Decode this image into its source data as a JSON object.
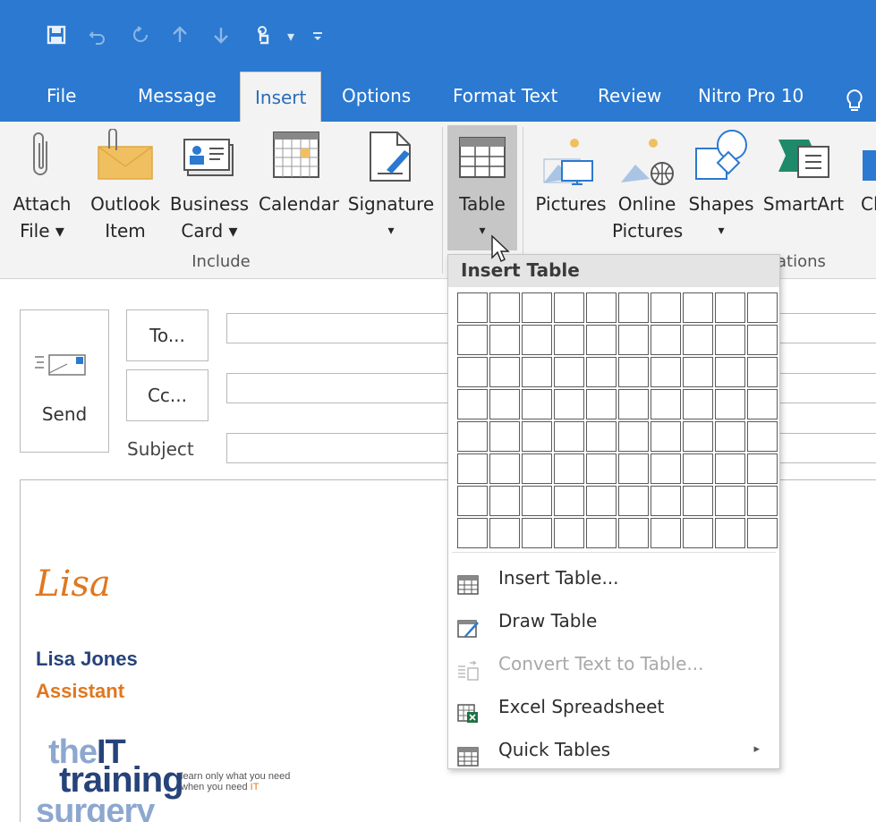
{
  "qat": {
    "icons": [
      "save-icon",
      "undo-icon",
      "redo-icon",
      "up-arrow-icon",
      "down-arrow-icon",
      "touch-mode-icon",
      "customize-icon"
    ],
    "touch_dropdown": "▾",
    "customize": "▾"
  },
  "tabs": [
    "File",
    "Message",
    "Insert",
    "Options",
    "Format Text",
    "Review",
    "Nitro Pro 10"
  ],
  "active_tab": "Insert",
  "ribbon": {
    "include": {
      "label": "Include",
      "buttons": [
        {
          "line1": "Attach",
          "line2": "File ▾"
        },
        {
          "line1": "Outlook",
          "line2": "Item"
        },
        {
          "line1": "Business",
          "line2": "Card ▾"
        },
        {
          "line1": "Calendar",
          "line2": ""
        },
        {
          "line1": "Signature",
          "line2": "▾"
        }
      ]
    },
    "table": {
      "line1": "Table",
      "line2": "▾"
    },
    "illustrations": {
      "label_partial": "ations",
      "buttons": [
        {
          "line1": "Pictures",
          "line2": ""
        },
        {
          "line1": "Online",
          "line2": "Pictures"
        },
        {
          "line1": "Shapes",
          "line2": "▾"
        },
        {
          "line1": "SmartArt",
          "line2": ""
        },
        {
          "line1": "Cl",
          "line2": ""
        }
      ]
    }
  },
  "compose": {
    "send": "Send",
    "to": "To...",
    "cc": "Cc...",
    "subject": "Subject"
  },
  "signature": {
    "script_name": "Lisa",
    "name": "Lisa Jones",
    "title": "Assistant",
    "logo_the": "the",
    "logo_it": "IT",
    "logo_training": "training",
    "logo_surgery": "surgery",
    "tagline_1": "learn only what you need",
    "tagline_2a": "when you need ",
    "tagline_2b": "IT"
  },
  "insert_table_menu": {
    "header": "Insert Table",
    "grid_cols": 10,
    "grid_rows": 8,
    "items": [
      {
        "label": "Insert Table...",
        "icon": "insert-table-icon",
        "enabled": true
      },
      {
        "label": "Draw Table",
        "icon": "draw-table-icon",
        "enabled": true
      },
      {
        "label": "Convert Text to Table...",
        "icon": "convert-text-icon",
        "enabled": false
      },
      {
        "label": "Excel Spreadsheet",
        "icon": "excel-icon",
        "enabled": true
      },
      {
        "label": "Quick Tables",
        "icon": "quick-tables-icon",
        "enabled": true,
        "submenu": "▸"
      }
    ]
  },
  "colors": {
    "title_bar": "#2b79d0",
    "ribbon_bg": "#f3f3f3",
    "accent_orange": "#e0771f",
    "navy": "#26437a"
  }
}
